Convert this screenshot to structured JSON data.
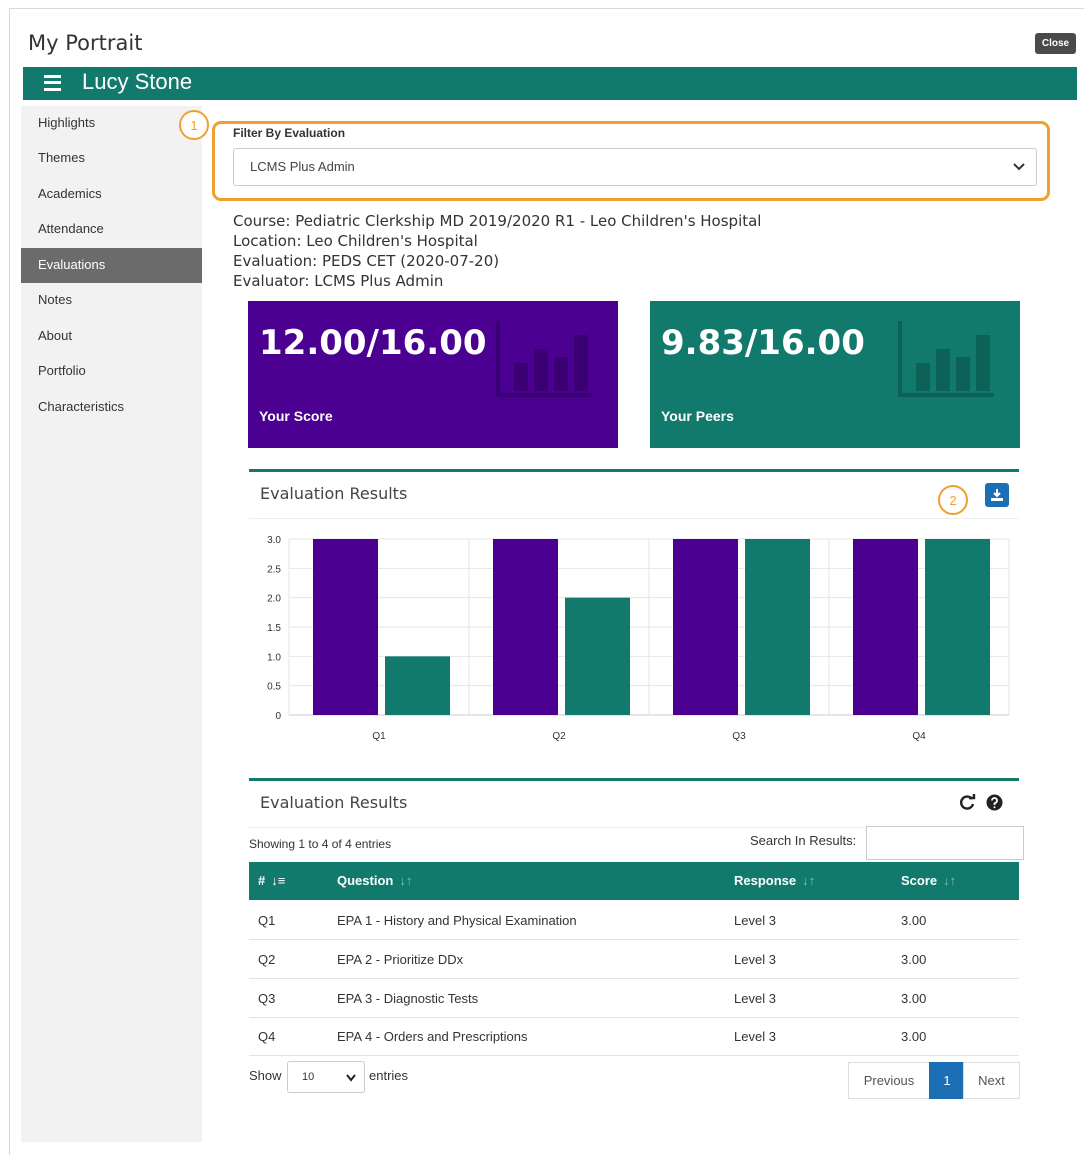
{
  "app": {
    "title": "My Portrait",
    "close_label": "Close"
  },
  "student": {
    "name": "Lucy Stone"
  },
  "sidebar": {
    "items": [
      {
        "label": "Highlights",
        "active": false
      },
      {
        "label": "Themes",
        "active": false
      },
      {
        "label": "Academics",
        "active": false
      },
      {
        "label": "Attendance",
        "active": false
      },
      {
        "label": "Evaluations",
        "active": true
      },
      {
        "label": "Notes",
        "active": false
      },
      {
        "label": "About",
        "active": false
      },
      {
        "label": "Portfolio",
        "active": false
      },
      {
        "label": "Characteristics",
        "active": false
      }
    ]
  },
  "callouts": {
    "one": "1",
    "two": "2"
  },
  "filter": {
    "label": "Filter By Evaluation",
    "value": "LCMS Plus Admin"
  },
  "meta": {
    "course": "Course: Pediatric Clerkship MD 2019/2020 R1 - Leo Children's Hospital",
    "location": "Location: Leo Children's Hospital",
    "evaluation": "Evaluation: PEDS CET (2020-07-20)",
    "evaluator": "Evaluator: LCMS Plus Admin"
  },
  "cards": {
    "your_score": {
      "value": "12.00/16.00",
      "label": "Your Score",
      "color": "#4b0092"
    },
    "your_peers": {
      "value": "9.83/16.00",
      "label": "Your Peers",
      "color": "#127a6d"
    }
  },
  "chart_panel": {
    "title": "Evaluation Results"
  },
  "chart_data": {
    "type": "bar",
    "categories": [
      "Q1",
      "Q2",
      "Q3",
      "Q4"
    ],
    "series": [
      {
        "values": [
          3,
          3,
          3,
          3
        ],
        "color": "#4b0092"
      },
      {
        "values": [
          1,
          2,
          3,
          3
        ],
        "color": "#127a6d"
      }
    ],
    "ylim": [
      0,
      3
    ],
    "yticks": [
      "0",
      "0.5",
      "1.0",
      "1.5",
      "2.0",
      "2.5",
      "3.0"
    ],
    "grid": true
  },
  "table_panel": {
    "title": "Evaluation Results"
  },
  "table": {
    "info": "Showing 1 to 4 of 4 entries",
    "search_label": "Search In Results:",
    "search_value": "",
    "columns": [
      "#",
      "Question",
      "Response",
      "Score"
    ],
    "rows": [
      {
        "num": "Q1",
        "question": "EPA 1 - History and Physical Examination",
        "response": "Level 3",
        "score": "3.00"
      },
      {
        "num": "Q2",
        "question": "EPA 2 - Prioritize DDx",
        "response": "Level 3",
        "score": "3.00"
      },
      {
        "num": "Q3",
        "question": "EPA 3 - Diagnostic Tests",
        "response": "Level 3",
        "score": "3.00"
      },
      {
        "num": "Q4",
        "question": "EPA 4 - Orders and Prescriptions",
        "response": "Level 3",
        "score": "3.00"
      }
    ],
    "length": {
      "show": "Show",
      "value": "10",
      "entries": "entries"
    },
    "pagination": {
      "previous": "Previous",
      "current": "1",
      "next": "Next"
    }
  },
  "colors": {
    "primary_teal": "#127a6d",
    "primary_purple": "#4b0092",
    "callout_orange": "#f0a030",
    "button_blue": "#1d6fb5"
  },
  "icons": {
    "menu": "hamburger-icon",
    "download": "download-icon",
    "refresh": "refresh-icon",
    "help": "help-icon",
    "sort": "sort-icon",
    "card_bg": "bar-chart-icon"
  }
}
